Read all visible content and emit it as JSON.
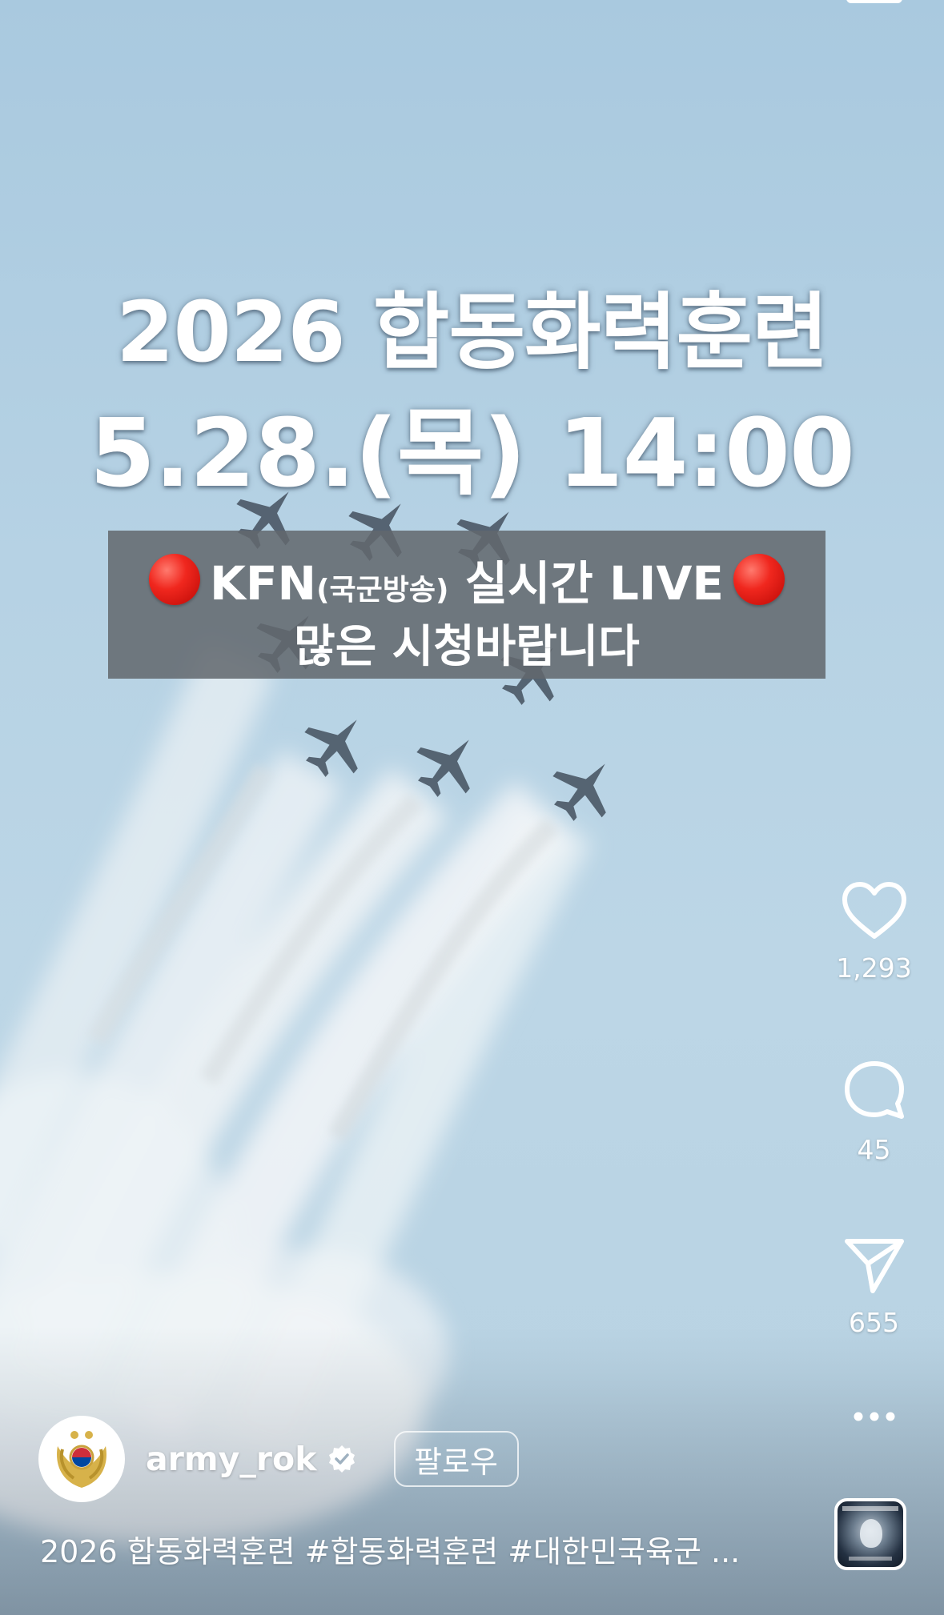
{
  "video": {
    "headline_line1": "2026 합동화력훈련",
    "headline_line2": "5.28.(목) 14:00",
    "banner": {
      "prefix": "KFN",
      "paren": "(국군방송)",
      "suffix": "실시간 LIVE",
      "line2": "많은 시청바랍니다"
    }
  },
  "actions": {
    "likes": "1,293",
    "comments": "45",
    "shares": "655"
  },
  "author": {
    "username": "army_rok",
    "follow_label": "팔로우"
  },
  "caption": "2026 합동화력훈련 #합동화력훈련 #대한민국육군 ...",
  "colors": {
    "sky": "#b6d2e4",
    "banner_bg": "#62686e",
    "live_dot": "#f0271e",
    "text": "#ffffff"
  },
  "icons": {
    "like": "heart-outline-icon",
    "comment": "speech-bubble-icon",
    "share": "paper-plane-icon",
    "more": "more-dots-icon",
    "verified": "verified-badge-icon"
  }
}
